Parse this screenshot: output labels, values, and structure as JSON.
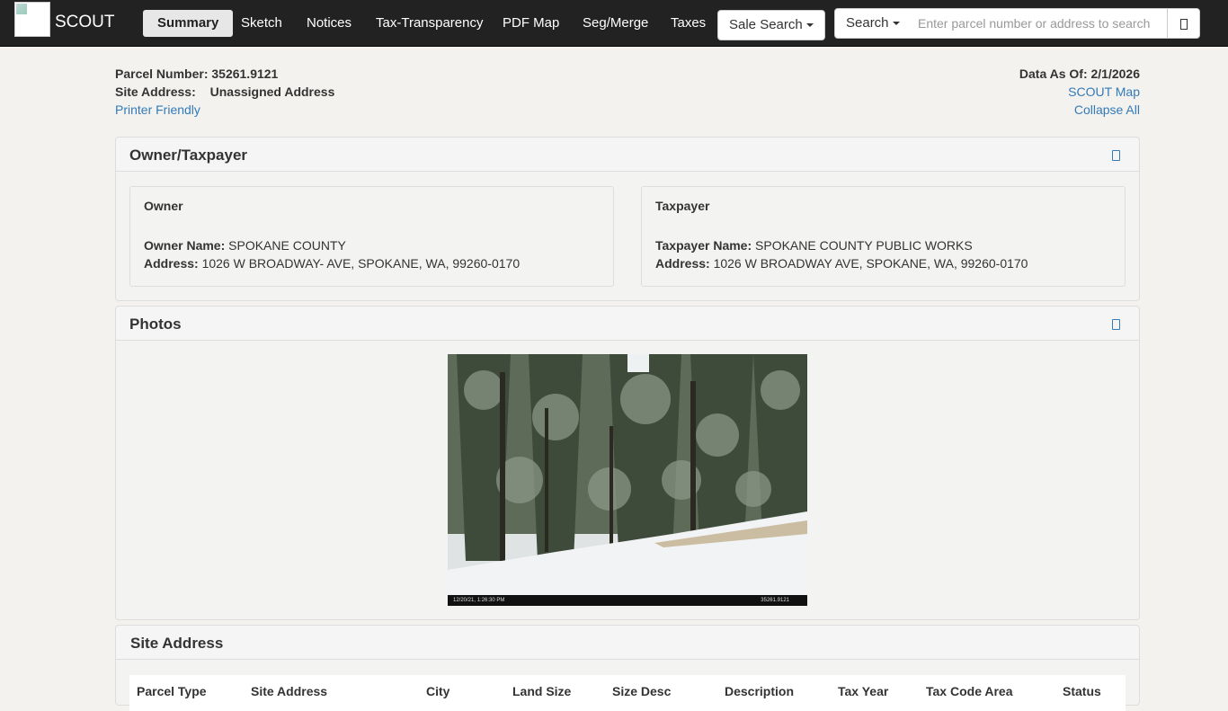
{
  "brand": {
    "name": "SCOUT"
  },
  "nav": {
    "items": [
      "Summary",
      "Sketch",
      "Notices",
      "Tax-Transparency",
      "PDF Map",
      "Seg/Merge",
      "Taxes"
    ],
    "sale_search": "Sale Search",
    "search_label": "Search",
    "search_placeholder": "Enter parcel number or address to search"
  },
  "header": {
    "parcel_label": "Parcel Number:",
    "parcel_value": "35261.9121",
    "site_label": "Site Address:",
    "site_value": "Unassigned Address",
    "printer_friendly": "Printer Friendly",
    "data_as_of_label": "Data As Of:",
    "data_as_of_value": "2/1/2026",
    "scout_map": "SCOUT Map",
    "collapse_all": "Collapse All"
  },
  "owner_panel": {
    "title": "Owner/Taxpayer",
    "owner": {
      "title": "Owner",
      "name_label": "Owner Name:",
      "name_value": "SPOKANE COUNTY",
      "address_label": "Address:",
      "address_value": "1026 W BROADWAY- AVE, SPOKANE, WA, 99260-0170"
    },
    "taxpayer": {
      "title": "Taxpayer",
      "name_label": "Taxpayer Name:",
      "name_value": "SPOKANE COUNTY PUBLIC WORKS",
      "address_label": "Address:",
      "address_value": "1026 W BROADWAY AVE, SPOKANE, WA, 99260-0170"
    }
  },
  "photos_panel": {
    "title": "Photos",
    "stamp_left": "12/20/21, 1:26:30 PM",
    "stamp_right": "35261.9121"
  },
  "site_panel": {
    "title": "Site Address",
    "columns": [
      "Parcel Type",
      "Site Address",
      "City",
      "Land Size",
      "Size Desc",
      "Description",
      "Tax Year",
      "Tax Code Area",
      "Status"
    ]
  },
  "colors": {
    "navbar": "#222222",
    "link": "#337ab7",
    "page_bg": "#f3f2ef"
  }
}
